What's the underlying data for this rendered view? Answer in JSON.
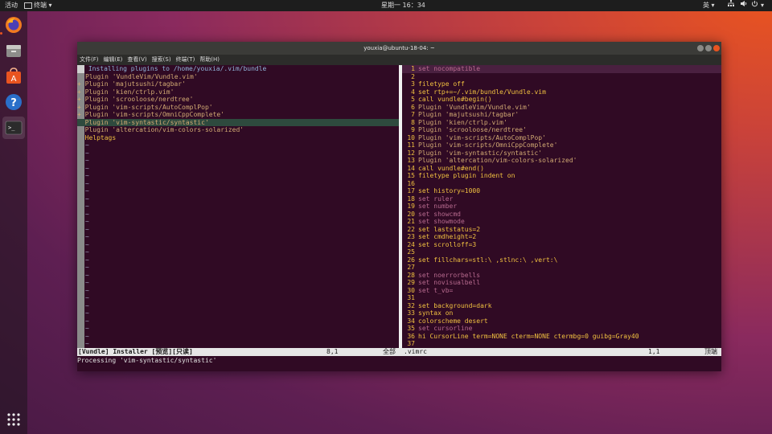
{
  "topbar": {
    "activities": "活动",
    "app_menu": "终端",
    "clock": "星期一 16：34",
    "input_method": "英"
  },
  "dock": {
    "items": [
      {
        "name": "Firefox",
        "icon": "firefox-icon"
      },
      {
        "name": "Files",
        "icon": "files-icon"
      },
      {
        "name": "Ubuntu Software",
        "icon": "software-icon"
      },
      {
        "name": "Help",
        "icon": "help-icon"
      },
      {
        "name": "Terminal",
        "icon": "terminal-icon"
      }
    ],
    "apps_grid": "show-apps-icon"
  },
  "window": {
    "title": "youxia@ubuntu-18-04: ~",
    "menu": [
      "文件(F)",
      "编辑(E)",
      "查看(V)",
      "搜索(S)",
      "终端(T)",
      "帮助(H)"
    ]
  },
  "left_pane": {
    "lines": [
      " Installing plugins to /home/youxia/.vim/bundle",
      "Plugin 'VundleVim/Vundle.vim'",
      "+ Plugin 'majutsushi/tagbar'",
      "+ Plugin 'kien/ctrlp.vim'",
      "+ Plugin 'scrooloose/nerdtree'",
      "+ Plugin 'vim-scripts/AutoComplPop'",
      "+ Plugin 'vim-scripts/OmniCppComplete'",
      "  Plugin 'vim-syntastic/syntastic'",
      "  Plugin 'altercation/vim-colors-solarized'",
      "  Helptags"
    ],
    "tilde": "~"
  },
  "right_pane": {
    "lines": [
      {
        "n": "1",
        "t": "set nocompatible"
      },
      {
        "n": "2",
        "t": ""
      },
      {
        "n": "3",
        "t": "filetype off"
      },
      {
        "n": "4",
        "t": "set rtp+=~/.vim/bundle/Vundle.vim"
      },
      {
        "n": "5",
        "t": "call vundle#begin()"
      },
      {
        "n": "6",
        "t": "Plugin 'VundleVim/Vundle.vim'"
      },
      {
        "n": "7",
        "t": "Plugin 'majutsushi/tagbar'"
      },
      {
        "n": "8",
        "t": "Plugin 'kien/ctrlp.vim'"
      },
      {
        "n": "9",
        "t": "Plugin 'scrooloose/nerdtree'"
      },
      {
        "n": "10",
        "t": "Plugin 'vim-scripts/AutoComplPop'"
      },
      {
        "n": "11",
        "t": "Plugin 'vim-scripts/OmniCppComplete'"
      },
      {
        "n": "12",
        "t": "Plugin 'vim-syntastic/syntastic'"
      },
      {
        "n": "13",
        "t": "Plugin 'altercation/vim-colors-solarized'"
      },
      {
        "n": "14",
        "t": "call vundle#end()"
      },
      {
        "n": "15",
        "t": "filetype plugin indent on"
      },
      {
        "n": "16",
        "t": ""
      },
      {
        "n": "17",
        "t": "set history=1000"
      },
      {
        "n": "18",
        "t": "set ruler"
      },
      {
        "n": "19",
        "t": "set number"
      },
      {
        "n": "20",
        "t": "set showcmd"
      },
      {
        "n": "21",
        "t": "set showmode"
      },
      {
        "n": "22",
        "t": "set laststatus=2"
      },
      {
        "n": "23",
        "t": "set cmdheight=2"
      },
      {
        "n": "24",
        "t": "set scrolloff=3"
      },
      {
        "n": "25",
        "t": ""
      },
      {
        "n": "26",
        "t": "set fillchars=stl:\\ ,stlnc:\\ ,vert:\\ "
      },
      {
        "n": "27",
        "t": ""
      },
      {
        "n": "28",
        "t": "set noerrorbells"
      },
      {
        "n": "29",
        "t": "set novisualbell"
      },
      {
        "n": "30",
        "t": "set t_vb="
      },
      {
        "n": "31",
        "t": ""
      },
      {
        "n": "32",
        "t": "set background=dark"
      },
      {
        "n": "33",
        "t": "syntax on"
      },
      {
        "n": "34",
        "t": "colorscheme desert"
      },
      {
        "n": "35",
        "t": "set cursorline"
      },
      {
        "n": "36",
        "t": "hi CursorLine term=NONE cterm=NONE ctermbg=0 guibg=Gray40"
      },
      {
        "n": "37",
        "t": ""
      }
    ]
  },
  "statusbar": {
    "left_name": "[Vundle] Installer [预览][只读]",
    "left_pos": "8,1",
    "left_scroll": "全部",
    "right_name": ".vimrc",
    "right_pos": "1,1",
    "right_scroll": "顶端"
  },
  "cmdline": "Processing 'vim-syntastic/syntastic'",
  "colors": {
    "accent": "#e95420",
    "terminal_bg": "#300a24"
  }
}
